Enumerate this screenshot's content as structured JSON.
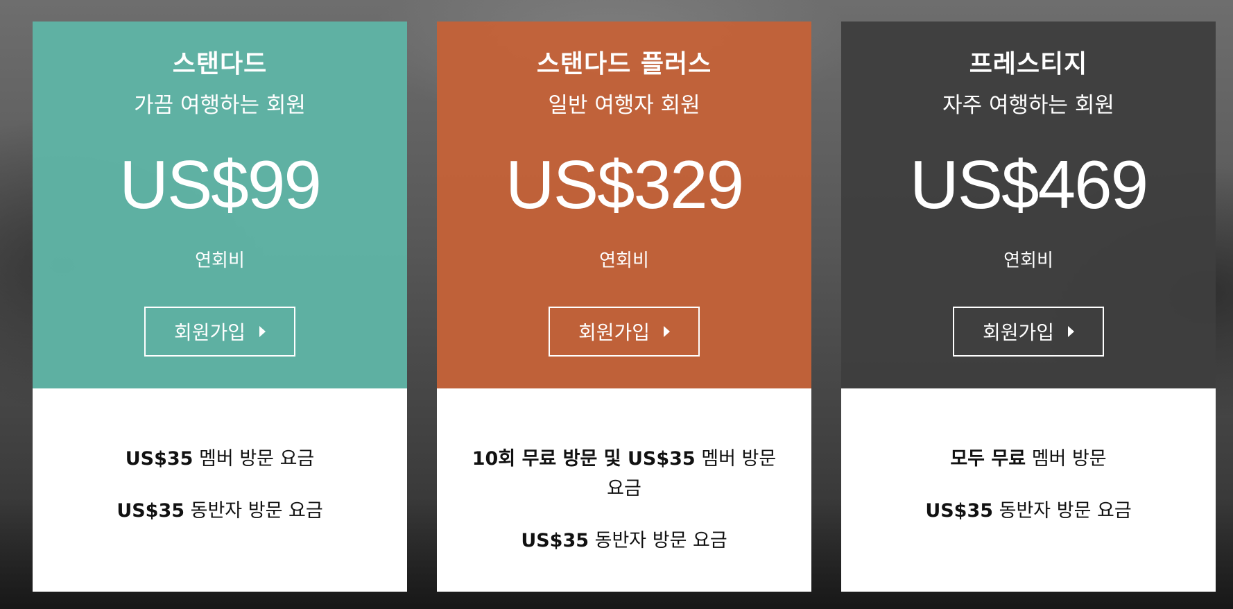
{
  "colors": {
    "standard": "#5fb4a5",
    "standard_plus": "#c46238",
    "prestige": "#3e3e3e"
  },
  "plans": [
    {
      "name": "스탠다드",
      "description": "가끔 여행하는 회원",
      "price": "US$99",
      "price_note": "연회비",
      "join_label": "회원가입",
      "benefits": [
        {
          "bold": "US$35",
          "rest": " 멤버 방문 요금"
        },
        {
          "bold": "US$35",
          "rest": " 동반자 방문 요금"
        }
      ]
    },
    {
      "name": "스탠다드 플러스",
      "description": "일반 여행자 회원",
      "price": "US$329",
      "price_note": "연회비",
      "join_label": "회원가입",
      "benefits": [
        {
          "bold": "10회 무료 방문 및 US$35",
          "rest": " 멤버 방문 요금"
        },
        {
          "bold": "US$35",
          "rest": " 동반자 방문 요금"
        }
      ]
    },
    {
      "name": "프레스티지",
      "description": "자주 여행하는 회원",
      "price": "US$469",
      "price_note": "연회비",
      "join_label": "회원가입",
      "benefits": [
        {
          "bold": "모두 무료",
          "rest": " 멤버 방문"
        },
        {
          "bold": "US$35",
          "rest": " 동반자 방문 요금"
        }
      ]
    }
  ]
}
